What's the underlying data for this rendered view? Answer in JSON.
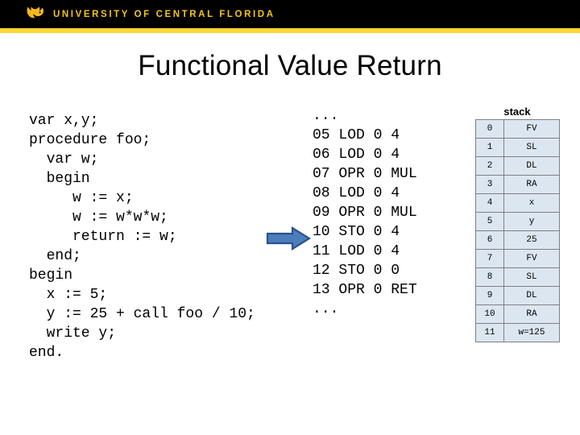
{
  "header": {
    "wordmark": "UNIVERSITY OF CENTRAL FLORIDA",
    "logo_icon": "pegasus-logo-icon",
    "bar_color": "#000000",
    "accent_color": "#FFD633",
    "wordmark_color": "#F5C518"
  },
  "slide": {
    "title": "Functional Value Return"
  },
  "source_code": {
    "lines": [
      "var x,y;",
      "procedure foo;",
      "  var w;",
      "  begin",
      "     w := x;",
      "     w := w*w*w;",
      "     return := w;",
      "  end;",
      "begin",
      "  x := 5;",
      "  y := 25 + call foo / 10;",
      "  write y;",
      "end."
    ],
    "text": "var x,y;\nprocedure foo;\n  var w;\n  begin\n     w := x;\n     w := w*w*w;\n     return := w;\n  end;\nbegin\n  x := 5;\n  y := 25 + call foo / 10;\n  write y;\nend."
  },
  "pmachine_code": {
    "leading_ellipsis": "...",
    "trailing_ellipsis": "...",
    "instructions": [
      {
        "address": "05",
        "op": "LOD",
        "level": "0",
        "operand": "4"
      },
      {
        "address": "06",
        "op": "LOD",
        "level": "0",
        "operand": "4"
      },
      {
        "address": "07",
        "op": "OPR",
        "level": "0",
        "operand": "MUL"
      },
      {
        "address": "08",
        "op": "LOD",
        "level": "0",
        "operand": "4"
      },
      {
        "address": "09",
        "op": "OPR",
        "level": "0",
        "operand": "MUL"
      },
      {
        "address": "10",
        "op": "STO",
        "level": "0",
        "operand": "4"
      },
      {
        "address": "11",
        "op": "LOD",
        "level": "0",
        "operand": "4"
      },
      {
        "address": "12",
        "op": "STO",
        "level": "0",
        "operand": "0"
      },
      {
        "address": "13",
        "op": "OPR",
        "level": "0",
        "operand": "RET"
      }
    ],
    "text": "...\n05 LOD 0 4\n06 LOD 0 4\n07 OPR 0 MUL\n08 LOD 0 4\n09 OPR 0 MUL\n10 STO 0 4\n11 LOD 0 4\n12 STO 0 0\n13 OPR 0 RET\n..."
  },
  "step_arrow": {
    "icon": "arrow-right-icon",
    "points_to_address": "10",
    "fill_color": "#4A7EBB",
    "stroke_color": "#28518C"
  },
  "stack": {
    "caption": "stack",
    "cell_background": "#DCE6F1",
    "cell_border": "#808080",
    "rows": [
      {
        "index": "0",
        "value": "FV"
      },
      {
        "index": "1",
        "value": "SL"
      },
      {
        "index": "2",
        "value": "DL"
      },
      {
        "index": "3",
        "value": "RA"
      },
      {
        "index": "4",
        "value": "x"
      },
      {
        "index": "5",
        "value": "y"
      },
      {
        "index": "6",
        "value": "25"
      },
      {
        "index": "7",
        "value": "FV"
      },
      {
        "index": "8",
        "value": "SL"
      },
      {
        "index": "9",
        "value": "DL"
      },
      {
        "index": "10",
        "value": "RA"
      },
      {
        "index": "11",
        "value": "w=125"
      }
    ]
  }
}
